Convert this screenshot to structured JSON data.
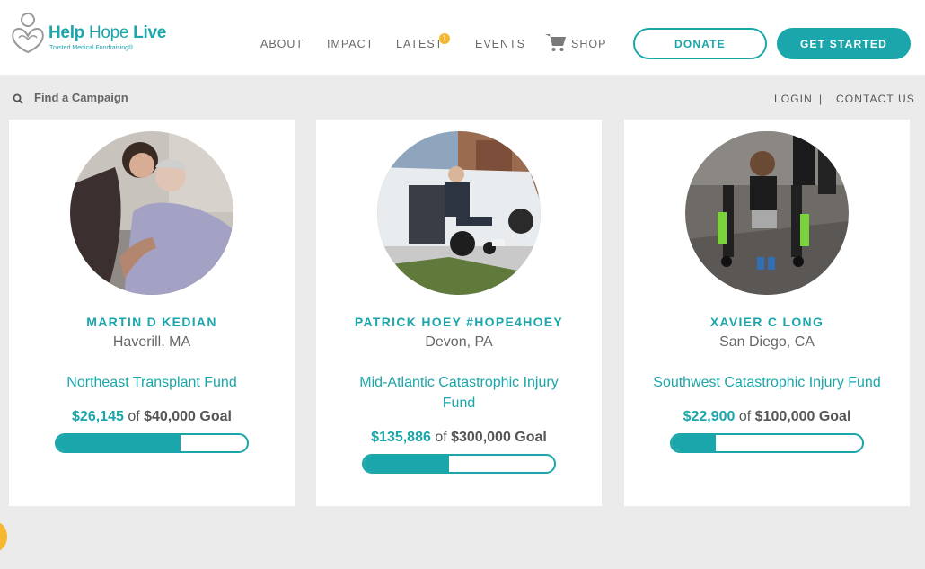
{
  "brand": {
    "name_part1": "Help",
    "name_part2": " Hope ",
    "name_part3": "Live",
    "tagline": "Trusted Medical Fundraising®",
    "color": "#1aa6ab"
  },
  "nav": {
    "items": [
      {
        "label": "ABOUT"
      },
      {
        "label": "IMPACT"
      },
      {
        "label": "LATEST",
        "badge": "1"
      },
      {
        "label": "EVENTS"
      },
      {
        "label": "SHOP",
        "icon": "shopping-cart-icon"
      }
    ],
    "donate_label": "DONATE",
    "get_started_label": "GET STARTED"
  },
  "subbar": {
    "search_label": "Find a Campaign",
    "login_label": "LOGIN",
    "separator": "|",
    "contact_label": "CONTACT US"
  },
  "campaigns": [
    {
      "name": "MARTIN D KEDIAN",
      "location": "Haverill, MA",
      "fund": "Northeast Transplant Fund",
      "raised": "$26,145",
      "of_text": " of ",
      "goal": "$40,000 Goal",
      "progress": 0.65
    },
    {
      "name": "PATRICK HOEY #HOPE4HOEY",
      "location": "Devon, PA",
      "fund": "Mid-Atlantic Catastrophic Injury Fund",
      "raised": "$135,886",
      "of_text": " of ",
      "goal": "$300,000 Goal",
      "progress": 0.45
    },
    {
      "name": "XAVIER C LONG",
      "location": "San Diego, CA",
      "fund": "Southwest Catastrophic Injury Fund",
      "raised": "$22,900",
      "of_text": " of ",
      "goal": "$100,000 Goal",
      "progress": 0.23
    }
  ]
}
